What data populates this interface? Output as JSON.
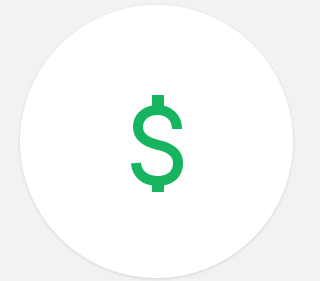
{
  "icon": {
    "name": "dollar-icon",
    "color": "#16b45f"
  }
}
